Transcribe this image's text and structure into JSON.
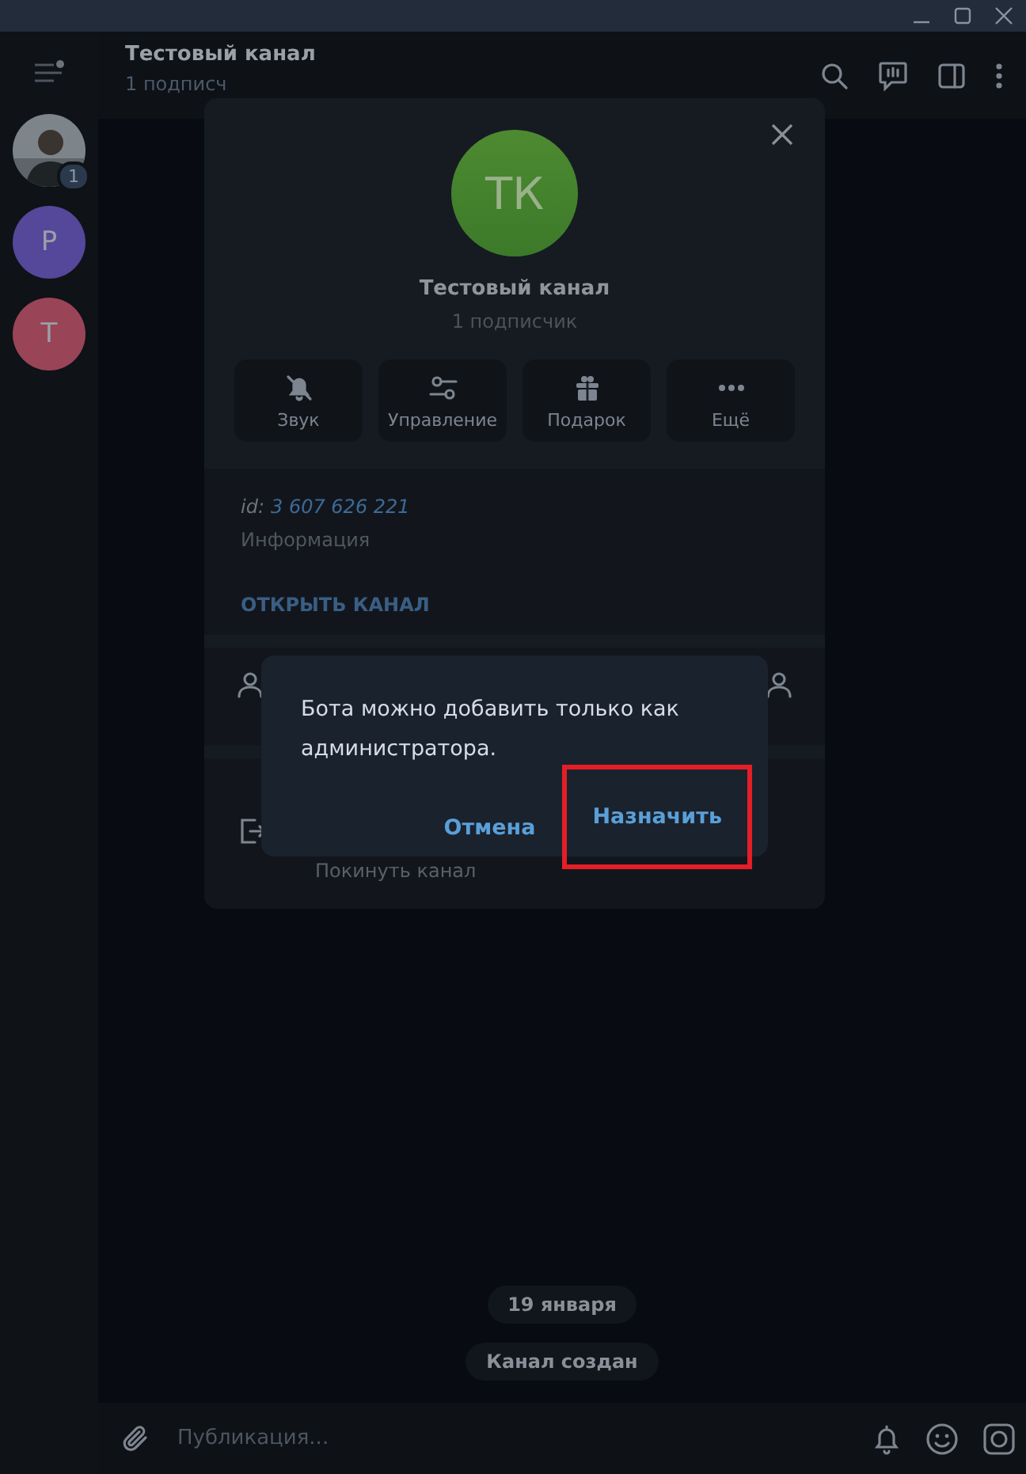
{
  "sidebar": {
    "chats": [
      {
        "badge": "1"
      },
      {
        "kind": "letter",
        "letter": "Р",
        "color": "#55479a"
      },
      {
        "kind": "letter",
        "letter": "Т",
        "color": "#9a4458"
      }
    ]
  },
  "chat": {
    "title": "Тестовый канал",
    "subtitle": "1 подписч",
    "service_messages": [
      "19 января",
      "Канал создан"
    ],
    "composer": {
      "placeholder": "Публикация..."
    }
  },
  "channel_info": {
    "initials": "ТК",
    "name": "Тестовый канал",
    "subscribers": "1 подписчик",
    "actions": [
      {
        "kind": "bell-off",
        "label": "Звук"
      },
      {
        "kind": "sliders",
        "label": "Управление"
      },
      {
        "kind": "gift",
        "label": "Подарок"
      },
      {
        "kind": "dots",
        "label": "Ещё"
      }
    ],
    "id_label": "id:",
    "id_value": "3 607 626 221",
    "id_caption": "Информация",
    "open_link": "ОТКРЫТЬ КАНАЛ",
    "leave": "Покинуть канал"
  },
  "dialog": {
    "message": "Бота можно добавить только как администратора.",
    "buttons": [
      {
        "label": "Отмена",
        "highlighted": false
      },
      {
        "label": "Назначить",
        "highlighted": true
      }
    ]
  }
}
